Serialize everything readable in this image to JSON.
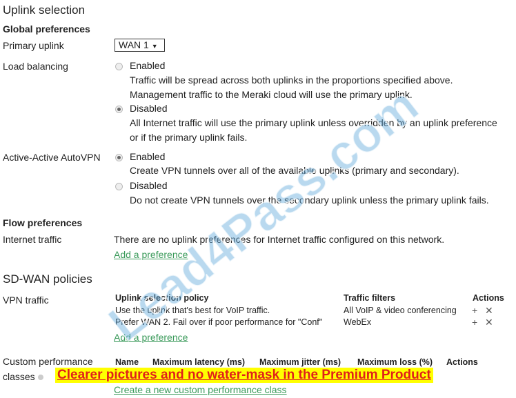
{
  "title": "Uplink selection",
  "global": {
    "heading": "Global preferences",
    "primary_label": "Primary uplink",
    "primary_value": "WAN 1",
    "lb_label": "Load balancing",
    "lb_enabled": "Enabled",
    "lb_enabled_desc1": "Traffic will be spread across both uplinks in the proportions specified above.",
    "lb_enabled_desc2": "Management traffic to the Meraki cloud will use the primary uplink.",
    "lb_disabled": "Disabled",
    "lb_disabled_desc1": "All Internet traffic will use the primary uplink unless overridden by an uplink preference",
    "lb_disabled_desc2": "or if the  primary uplink fails.",
    "lb_selected": "Disabled",
    "aa_label": "Active-Active AutoVPN",
    "aa_enabled": "Enabled",
    "aa_enabled_desc": "Create VPN tunnels over all of the available uplinks (primary and secondary).",
    "aa_disabled": "Disabled",
    "aa_disabled_desc": "Do not create VPN tunnels over the secondary uplink unless the primary uplink fails.",
    "aa_selected": "Enabled"
  },
  "flow": {
    "heading": "Flow preferences",
    "internet_label": "Internet traffic",
    "internet_text": "There are no uplink preferences for Internet traffic configured on this network.",
    "add_link": "Add a preference"
  },
  "sdwan": {
    "heading": "SD-WAN policies",
    "vpn_label": "VPN traffic",
    "columns": [
      "Uplink selection policy",
      "Traffic filters",
      "Actions"
    ],
    "rows": [
      {
        "policy": "Use the uplink that's best for VoIP traffic.",
        "filter": "All VoIP & video conferencing"
      },
      {
        "policy": "Prefer WAN 2. Fail over if poor performance for \"Conf\"",
        "filter": "WebEx"
      }
    ],
    "add_link": "Add a preference",
    "custom_label1": "Custom performance",
    "custom_label2": "classes",
    "custom_columns": [
      "Name",
      "Maximum latency (ms)",
      "Maximum jitter (ms)",
      "Maximum loss (%)",
      "Actions"
    ],
    "create_link": "Create a new custom performance class"
  },
  "watermark": "Lead4Pass.com",
  "banner": "Clearer pictures and no water-mask in the Premium Product"
}
